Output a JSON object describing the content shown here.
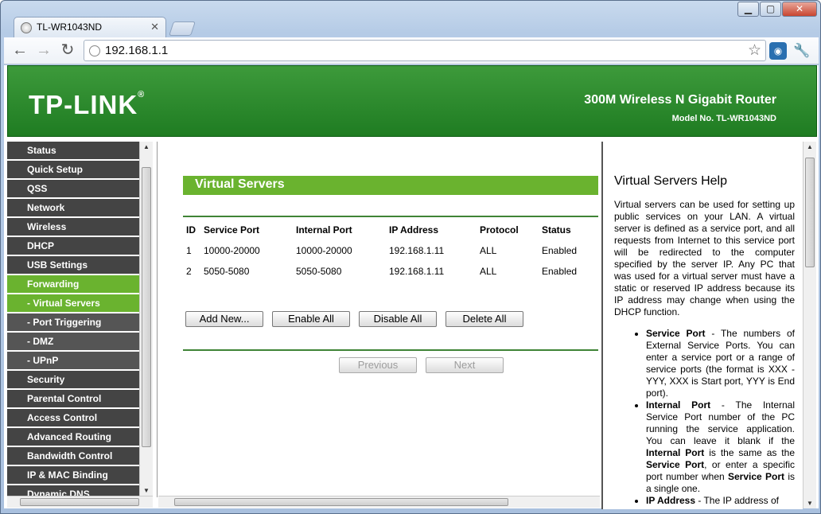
{
  "browser": {
    "tab_title": "TL-WR1043ND",
    "url": "192.168.1.1"
  },
  "header": {
    "logo": "TP-LINK",
    "product": "300M Wireless N Gigabit Router",
    "model": "Model No. TL-WR1043ND"
  },
  "menu": [
    {
      "label": "Status",
      "state": "normal"
    },
    {
      "label": "Quick Setup",
      "state": "normal"
    },
    {
      "label": "QSS",
      "state": "normal"
    },
    {
      "label": "Network",
      "state": "normal"
    },
    {
      "label": "Wireless",
      "state": "normal"
    },
    {
      "label": "DHCP",
      "state": "normal"
    },
    {
      "label": "USB Settings",
      "state": "normal"
    },
    {
      "label": "Forwarding",
      "state": "active"
    },
    {
      "label": "- Virtual Servers",
      "state": "subactive"
    },
    {
      "label": "- Port Triggering",
      "state": "sub"
    },
    {
      "label": "- DMZ",
      "state": "sub"
    },
    {
      "label": "- UPnP",
      "state": "sub"
    },
    {
      "label": "Security",
      "state": "normal"
    },
    {
      "label": "Parental Control",
      "state": "normal"
    },
    {
      "label": "Access Control",
      "state": "normal"
    },
    {
      "label": "Advanced Routing",
      "state": "normal"
    },
    {
      "label": "Bandwidth Control",
      "state": "normal"
    },
    {
      "label": "IP & MAC Binding",
      "state": "normal"
    },
    {
      "label": "Dynamic DNS",
      "state": "normal"
    }
  ],
  "main": {
    "title": "Virtual Servers",
    "columns": [
      "ID",
      "Service Port",
      "Internal Port",
      "IP Address",
      "Protocol",
      "Status"
    ],
    "rows": [
      [
        "1",
        "10000-20000",
        "10000-20000",
        "192.168.1.11",
        "ALL",
        "Enabled"
      ],
      [
        "2",
        "5050-5080",
        "5050-5080",
        "192.168.1.11",
        "ALL",
        "Enabled"
      ]
    ],
    "buttons": {
      "add_new": "Add New...",
      "enable_all": "Enable All",
      "disable_all": "Disable All",
      "delete_all": "Delete All",
      "previous": "Previous",
      "next": "Next"
    }
  },
  "help": {
    "title": "Virtual Servers Help",
    "intro": "Virtual servers can be used for setting up public services on your LAN. A virtual server is defined as a service port, and all requests from Internet to this service port will be redirected to the computer specified by the server IP. Any PC that was used for a virtual server must have a static or reserved IP address because its IP address may change when using the DHCP function.",
    "service_port_term": "Service Port",
    "service_port_desc": " - The numbers of External Service Ports. You can enter a service port or a range of service ports (the format is XXX - YYY, XXX is Start port, YYY is End port).",
    "internal_port_term": "Internal Port",
    "internal_port_desc1": " - The Internal Service Port number of the PC running the service application. You can leave it blank if the ",
    "internal_port_term2": "Internal Port",
    "internal_port_desc2": " is the same as the ",
    "service_port_term2": "Service Port",
    "internal_port_desc3": ", or enter a specific port number when ",
    "service_port_term3": "Service Port",
    "internal_port_desc4": " is a single one.",
    "ip_address_term": "IP Address",
    "ip_address_desc": " - The IP address of"
  }
}
